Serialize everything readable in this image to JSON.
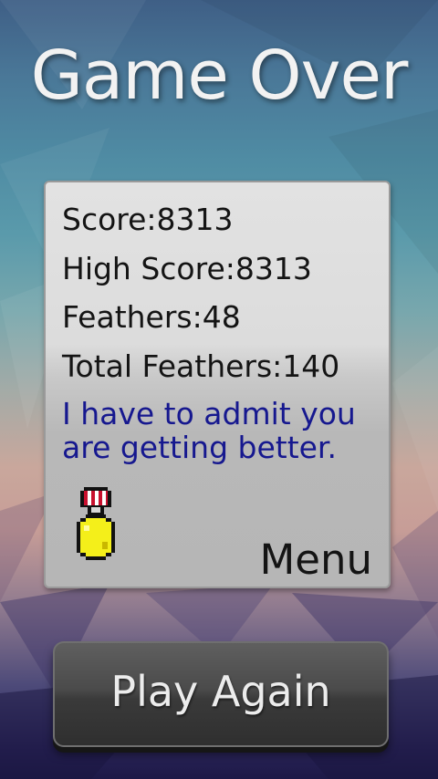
{
  "screen": {
    "title": "Game Over"
  },
  "results": {
    "score": "Score:8313",
    "high_score": "High Score:8313",
    "feathers": "Feathers:48",
    "total_feathers": "Total Feathers:140",
    "message": "I have to admit you are getting better.",
    "medal_icon": "gold-medal-icon",
    "menu_label": "Menu"
  },
  "actions": {
    "play_again_label": "Play Again"
  },
  "colors": {
    "message_text": "#16188f",
    "medal_gold": "#f4ef1a",
    "ribbon_red": "#c8102e"
  }
}
